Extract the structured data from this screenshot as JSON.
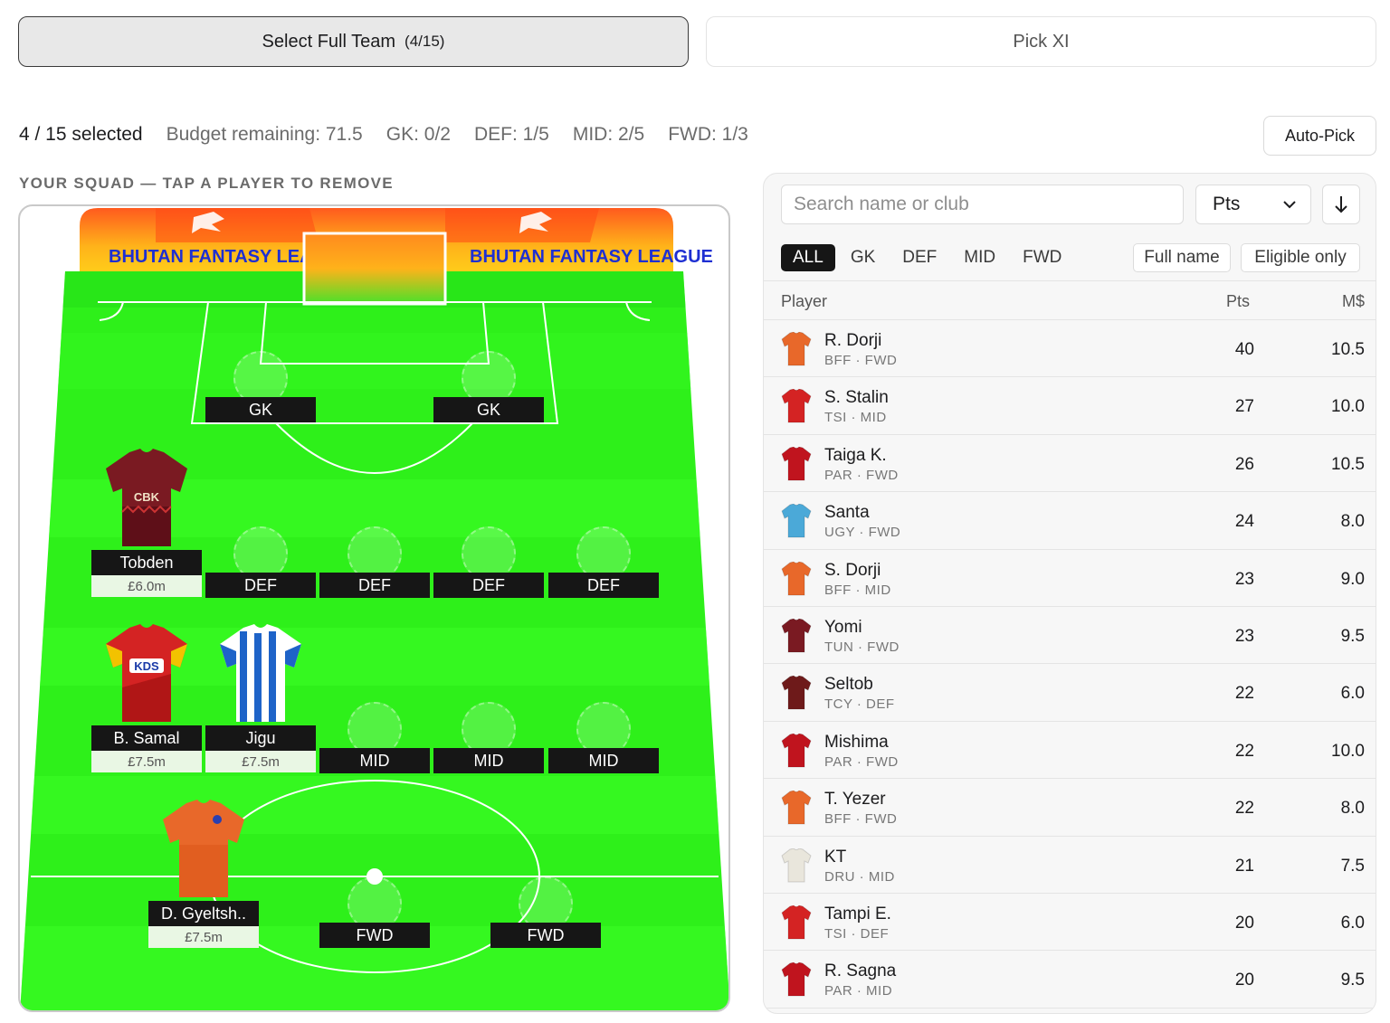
{
  "tabs": {
    "select_full_team": "Select Full Team",
    "select_full_team_count": "(4/15)",
    "pick_xi": "Pick XI"
  },
  "summary": {
    "selected": "4 / 15 selected",
    "budget": "Budget remaining: 71.5",
    "gk": "GK: 0/2",
    "def": "DEF: 1/5",
    "mid": "MID: 2/5",
    "fwd": "FWD: 1/3",
    "autopick": "Auto-Pick"
  },
  "squad_label": "YOUR SQUAD — TAP A PLAYER TO REMOVE",
  "pitch": {
    "banner_text_left": "BHUTAN FANTASY LEAGUE",
    "banner_text_right": "BHUTAN FANTASY LEAGUE",
    "pitch_color": "#2ef01a",
    "empty_slots": {
      "gk1": "GK",
      "gk2": "GK",
      "def1": "DEF",
      "def2": "DEF",
      "def3": "DEF",
      "def4": "DEF",
      "mid1": "MID",
      "mid2": "MID",
      "mid3": "MID",
      "fwd1": "FWD",
      "fwd2": "FWD"
    },
    "players": {
      "tobden": {
        "name": "Tobden",
        "price": "£6.0m",
        "kit": "maroon-cbk-shirt"
      },
      "samal": {
        "name": "B. Samal",
        "price": "£7.5m",
        "kit": "red-kds-shirt"
      },
      "jigu": {
        "name": "Jigu",
        "price": "£7.5m",
        "kit": "blue-white-striped-shirt"
      },
      "gyeltsh": {
        "name": "D. Gyeltsh..",
        "price": "£7.5m",
        "kit": "orange-shirt"
      }
    }
  },
  "list": {
    "search_placeholder": "Search name or club",
    "sort_value": "Pts",
    "positions": [
      "ALL",
      "GK",
      "DEF",
      "MID",
      "FWD"
    ],
    "full_name": "Full name",
    "eligible_only": "Eligible only",
    "headers": {
      "player": "Player",
      "pts": "Pts",
      "cost": "M$"
    },
    "rows": [
      {
        "name": "R. Dorji",
        "meta": "BFF · FWD",
        "pts": "40",
        "cost": "10.5",
        "kit_color": "#e8682a"
      },
      {
        "name": "S. Stalin",
        "meta": "TSI · MID",
        "pts": "27",
        "cost": "10.0",
        "kit_color": "#d42323"
      },
      {
        "name": "Taiga K.",
        "meta": "PAR · FWD",
        "pts": "26",
        "cost": "10.5",
        "kit_color": "#c0141e"
      },
      {
        "name": "Santa",
        "meta": "UGY · FWD",
        "pts": "24",
        "cost": "8.0",
        "kit_color": "#4ba9d8"
      },
      {
        "name": "S. Dorji",
        "meta": "BFF · MID",
        "pts": "23",
        "cost": "9.0",
        "kit_color": "#e8682a"
      },
      {
        "name": "Yomi",
        "meta": "TUN · FWD",
        "pts": "23",
        "cost": "9.5",
        "kit_color": "#7a1a22"
      },
      {
        "name": "Seltob",
        "meta": "TCY · DEF",
        "pts": "22",
        "cost": "6.0",
        "kit_color": "#6e1a1a"
      },
      {
        "name": "Mishima",
        "meta": "PAR · FWD",
        "pts": "22",
        "cost": "10.0",
        "kit_color": "#c0141e"
      },
      {
        "name": "T. Yezer",
        "meta": "BFF · FWD",
        "pts": "22",
        "cost": "8.0",
        "kit_color": "#e8682a"
      },
      {
        "name": "KT",
        "meta": "DRU · MID",
        "pts": "21",
        "cost": "7.5",
        "kit_color": "#e9e6dc"
      },
      {
        "name": "Tampi E.",
        "meta": "TSI · DEF",
        "pts": "20",
        "cost": "6.0",
        "kit_color": "#d42323"
      },
      {
        "name": "R. Sagna",
        "meta": "PAR · MID",
        "pts": "20",
        "cost": "9.5",
        "kit_color": "#c0141e"
      }
    ]
  }
}
